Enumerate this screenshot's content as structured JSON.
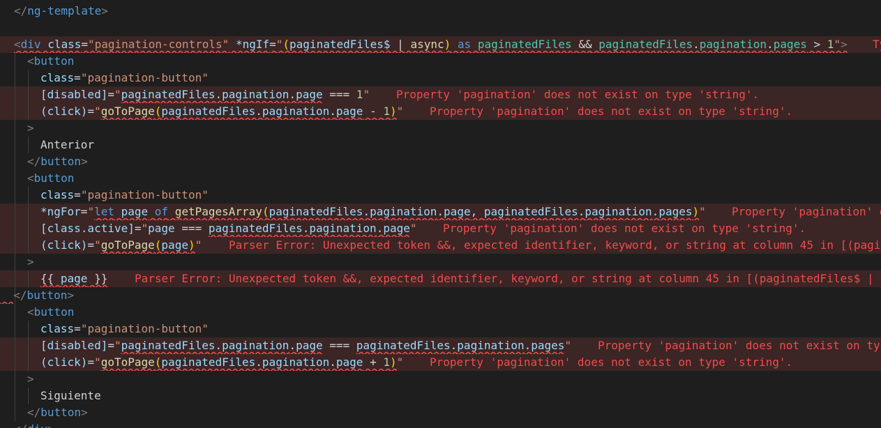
{
  "editor": {
    "language": "html",
    "lines": [
      {
        "text": "</ng-template>"
      },
      {
        "text": ""
      },
      {
        "text": "<div class=\"pagination-controls\" *ngIf=\"(paginatedFiles$ | async) as paginatedFiles && paginatedFiles.pagination.pages > 1\">",
        "diagnostic": "Ty"
      },
      {
        "text": "  <button"
      },
      {
        "text": "    class=\"pagination-button\""
      },
      {
        "text": "    [disabled]=\"paginatedFiles.pagination.page === 1\"",
        "diagnostic": "Property 'pagination' does not exist on type 'string'."
      },
      {
        "text": "    (click)=\"goToPage(paginatedFiles.pagination.page - 1)\"",
        "diagnostic": "Property 'pagination' does not exist on type 'string'."
      },
      {
        "text": "  >"
      },
      {
        "text": "    Anterior"
      },
      {
        "text": "  </button>"
      },
      {
        "text": "  <button"
      },
      {
        "text": "    class=\"pagination-button\""
      },
      {
        "text": "    *ngFor=\"let page of getPagesArray(paginatedFiles.pagination.page, paginatedFiles.pagination.pages)\"",
        "diagnostic": "Property 'pagination' d"
      },
      {
        "text": "    [class.active]=\"page === paginatedFiles.pagination.page\"",
        "diagnostic": "Property 'pagination' does not exist on type 'string'."
      },
      {
        "text": "    (click)=\"goToPage(page)\"",
        "diagnostic": "Parser Error: Unexpected token &&, expected identifier, keyword, or string at column 45 in [(pagin"
      },
      {
        "text": "  >"
      },
      {
        "text": "    {{ page }}",
        "diagnostic": "Parser Error: Unexpected token &&, expected identifier, keyword, or string at column 45 in [(paginatedFiles$ | a"
      },
      {
        "text": "  </button>"
      },
      {
        "text": "  <button"
      },
      {
        "text": "    class=\"pagination-button\""
      },
      {
        "text": "    [disabled]=\"paginatedFiles.pagination.page === paginatedFiles.pagination.pages\"",
        "diagnostic": "Property 'pagination' does not exist on typ"
      },
      {
        "text": "    (click)=\"goToPage(paginatedFiles.pagination.page + 1)\"",
        "diagnostic": "Property 'pagination' does not exist on type 'string'."
      },
      {
        "text": "  >"
      },
      {
        "text": "    Siguiente"
      },
      {
        "text": "  </button>"
      },
      {
        "text": "</div>"
      }
    ]
  },
  "colors": {
    "background": "#1e1e1e",
    "error_line": "#3b2525",
    "error_text": "#f14c4c"
  }
}
